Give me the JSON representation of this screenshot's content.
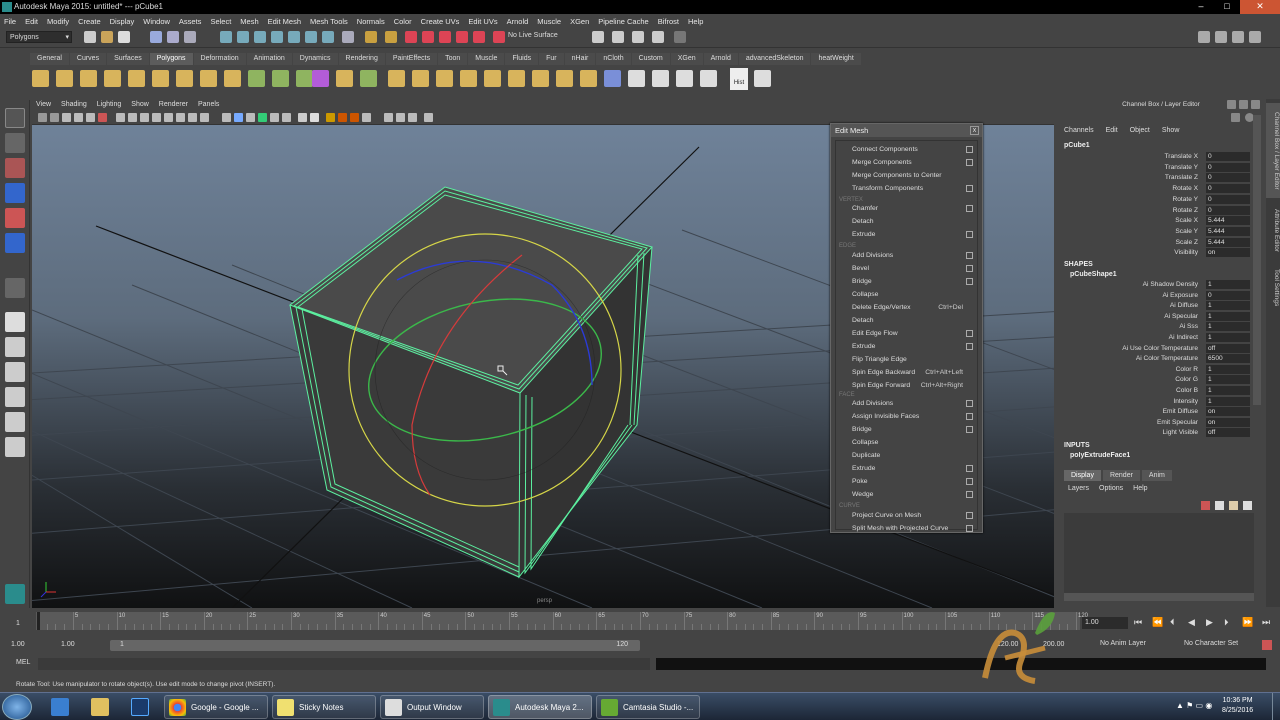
{
  "window": {
    "title": "Autodesk Maya 2015: untitled*    ---    pCube1",
    "min": "–",
    "max": "□",
    "close": "✕"
  },
  "menubar": [
    "File",
    "Edit",
    "Modify",
    "Create",
    "Display",
    "Window",
    "Assets",
    "Select",
    "Mesh",
    "Edit Mesh",
    "Mesh Tools",
    "Normals",
    "Color",
    "Create UVs",
    "Edit UVs",
    "Arnold",
    "Muscle",
    "XGen",
    "Pipeline Cache",
    "Bifrost",
    "Help"
  ],
  "statusline": {
    "mode": "Polygons",
    "live_surface": "No Live Surface"
  },
  "shelf_tabs": [
    "General",
    "Curves",
    "Surfaces",
    "Polygons",
    "Deformation",
    "Animation",
    "Dynamics",
    "Rendering",
    "PaintEffects",
    "Toon",
    "Muscle",
    "Fluids",
    "Fur",
    "nHair",
    "nCloth",
    "Custom",
    "XGen",
    "Arnold",
    "advancedSkeleton",
    "heatWeight"
  ],
  "shelf_active": "Polygons",
  "shelf_hist_label": "Hist",
  "viewport_menu": [
    "View",
    "Shading",
    "Lighting",
    "Show",
    "Renderer",
    "Panels"
  ],
  "viewport_camera_label": "persp",
  "edit_mesh": {
    "title": "Edit Mesh",
    "close": "x",
    "sections": {
      "vertex": "VERTEX",
      "edge": "EDGE",
      "face": "FACE",
      "curve": "CURVE"
    },
    "items": [
      {
        "label": "Connect Components",
        "option": true
      },
      {
        "label": "Merge Components",
        "option": true
      },
      {
        "label": "Merge Components to Center",
        "option": false
      },
      {
        "label": "Transform Components",
        "option": true
      },
      {
        "label": "Chamfer",
        "option": true
      },
      {
        "label": "Detach",
        "option": false
      },
      {
        "label": "Extrude",
        "option": true
      },
      {
        "label": "Add Divisions",
        "option": true
      },
      {
        "label": "Bevel",
        "option": true
      },
      {
        "label": "Bridge",
        "option": true
      },
      {
        "label": "Collapse",
        "option": false
      },
      {
        "label": "Delete Edge/Vertex",
        "option": false,
        "shortcut": "Ctrl+Del"
      },
      {
        "label": "Detach",
        "option": false
      },
      {
        "label": "Edit Edge Flow",
        "option": true
      },
      {
        "label": "Extrude",
        "option": true
      },
      {
        "label": "Flip Triangle Edge",
        "option": false
      },
      {
        "label": "Spin Edge Backward",
        "option": false,
        "shortcut": "Ctrl+Alt+Left"
      },
      {
        "label": "Spin Edge Forward",
        "option": false,
        "shortcut": "Ctrl+Alt+Right"
      },
      {
        "label": "Add Divisions",
        "option": true
      },
      {
        "label": "Assign Invisible Faces",
        "option": true
      },
      {
        "label": "Bridge",
        "option": true
      },
      {
        "label": "Collapse",
        "option": false
      },
      {
        "label": "Duplicate",
        "option": false
      },
      {
        "label": "Extrude",
        "option": true
      },
      {
        "label": "Poke",
        "option": true
      },
      {
        "label": "Wedge",
        "option": true
      },
      {
        "label": "Project Curve on Mesh",
        "option": true
      },
      {
        "label": "Split Mesh with Projected Curve",
        "option": true
      }
    ]
  },
  "channel_box": {
    "panel_title": "Channel Box / Layer Editor",
    "menus": [
      "Channels",
      "Edit",
      "Object",
      "Show"
    ],
    "object": "pCube1",
    "attrs": [
      {
        "label": "Translate X",
        "value": "0"
      },
      {
        "label": "Translate Y",
        "value": "0"
      },
      {
        "label": "Translate Z",
        "value": "0"
      },
      {
        "label": "Rotate X",
        "value": "0"
      },
      {
        "label": "Rotate Y",
        "value": "0"
      },
      {
        "label": "Rotate Z",
        "value": "0"
      },
      {
        "label": "Scale X",
        "value": "5.444"
      },
      {
        "label": "Scale Y",
        "value": "5.444"
      },
      {
        "label": "Scale Z",
        "value": "5.444"
      },
      {
        "label": "Visibility",
        "value": "on"
      }
    ],
    "shapes_header": "SHAPES",
    "shape_name": "pCubeShape1",
    "shape_attrs": [
      {
        "label": "Ai Shadow Density",
        "value": "1"
      },
      {
        "label": "Ai Exposure",
        "value": "0"
      },
      {
        "label": "Ai Diffuse",
        "value": "1"
      },
      {
        "label": "Ai Specular",
        "value": "1"
      },
      {
        "label": "Ai Sss",
        "value": "1"
      },
      {
        "label": "Ai Indirect",
        "value": "1"
      },
      {
        "label": "Ai Use Color Temperature",
        "value": "off"
      },
      {
        "label": "Ai Color Temperature",
        "value": "6500"
      },
      {
        "label": "Color R",
        "value": "1"
      },
      {
        "label": "Color G",
        "value": "1"
      },
      {
        "label": "Color B",
        "value": "1"
      },
      {
        "label": "Intensity",
        "value": "1"
      },
      {
        "label": "Emit Diffuse",
        "value": "on"
      },
      {
        "label": "Emit Specular",
        "value": "on"
      },
      {
        "label": "Light Visible",
        "value": "off"
      }
    ],
    "inputs_header": "INPUTS",
    "input_name": "polyExtrudeFace1"
  },
  "layer_editor": {
    "tabs": [
      "Display",
      "Render",
      "Anim"
    ],
    "active": "Display",
    "menus": [
      "Layers",
      "Options",
      "Help"
    ]
  },
  "side_tabs": [
    "Channel Box / Layer Editor",
    "Attribute Editor",
    "Tool Settings"
  ],
  "time_slider": {
    "ticks": [
      "5",
      "10",
      "15",
      "20",
      "25",
      "30",
      "35",
      "40",
      "45",
      "50",
      "55",
      "60",
      "65",
      "70",
      "75",
      "80",
      "85",
      "90",
      "95",
      "100",
      "105",
      "110",
      "115",
      "120"
    ],
    "frame_left": "1",
    "current_frame": "1.00"
  },
  "range_slider": {
    "start": "1.00",
    "start_inner": "1.00",
    "range_start": "1",
    "range_end": "120",
    "end_inner": "120.00",
    "end": "200.00",
    "anim_layer": "No Anim Layer",
    "character_set": "No Character Set"
  },
  "command_line": {
    "label": "MEL"
  },
  "help_line": "Rotate Tool: Use manipulator to rotate object(s). Use edit mode to change pivot (INSERT).",
  "taskbar": {
    "tasks": [
      {
        "label": "Google - Google ..."
      },
      {
        "label": "Sticky Notes"
      },
      {
        "label": "Output Window"
      },
      {
        "label": "Autodesk Maya 2..."
      },
      {
        "label": "Camtasia Studio -..."
      }
    ],
    "time": "10:36 PM",
    "date": "8/25/2016"
  },
  "colors": {
    "accent_green": "#4de08a",
    "maya_teal": "#2a8c8c"
  }
}
